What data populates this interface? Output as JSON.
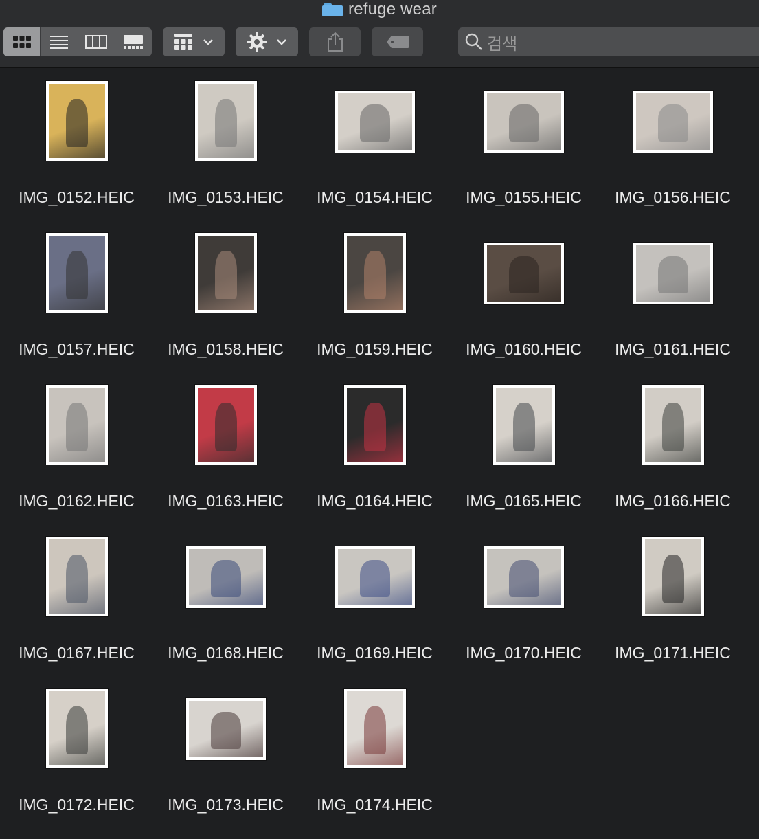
{
  "window": {
    "title": "refuge wear"
  },
  "toolbar": {
    "view_modes": [
      {
        "name": "icon-view",
        "icon": "grid-icon",
        "active": true
      },
      {
        "name": "list-view",
        "icon": "list-icon",
        "active": false
      },
      {
        "name": "column-view",
        "icon": "columns-icon",
        "active": false
      },
      {
        "name": "gallery-view",
        "icon": "gallery-icon",
        "active": false
      }
    ],
    "group_icon": "group-grid-icon",
    "action_icon": "gear-icon",
    "share_icon": "share-icon",
    "tag_icon": "tag-icon",
    "search_placeholder": "검색"
  },
  "files": [
    {
      "name": "IMG_0152.HEIC",
      "orient": "portrait",
      "bg": "#d9b35a",
      "fg": "#222"
    },
    {
      "name": "IMG_0153.HEIC",
      "orient": "portrait",
      "bg": "#cfcac2",
      "fg": "#777"
    },
    {
      "name": "IMG_0154.HEIC",
      "orient": "landscape",
      "bg": "#d4cfc8",
      "fg": "#666"
    },
    {
      "name": "IMG_0155.HEIC",
      "orient": "landscape",
      "bg": "#c9c4bd",
      "fg": "#666"
    },
    {
      "name": "IMG_0156.HEIC",
      "orient": "landscape",
      "bg": "#cec7c0",
      "fg": "#888"
    },
    {
      "name": "IMG_0157.HEIC",
      "orient": "portrait",
      "bg": "#6a6f86",
      "fg": "#333"
    },
    {
      "name": "IMG_0158.HEIC",
      "orient": "portrait",
      "bg": "#3f3b38",
      "fg": "#a88a7a"
    },
    {
      "name": "IMG_0159.HEIC",
      "orient": "portrait",
      "bg": "#4b4642",
      "fg": "#b0826a"
    },
    {
      "name": "IMG_0160.HEIC",
      "orient": "landscape",
      "bg": "#5a4d44",
      "fg": "#2b2420"
    },
    {
      "name": "IMG_0161.HEIC",
      "orient": "landscape",
      "bg": "#c4c1bd",
      "fg": "#777"
    },
    {
      "name": "IMG_0162.HEIC",
      "orient": "portrait",
      "bg": "#c8c3bd",
      "fg": "#777"
    },
    {
      "name": "IMG_0163.HEIC",
      "orient": "portrait",
      "bg": "#c23b47",
      "fg": "#2d2d2d"
    },
    {
      "name": "IMG_0164.HEIC",
      "orient": "portrait",
      "bg": "#2b2b2b",
      "fg": "#c33344"
    },
    {
      "name": "IMG_0165.HEIC",
      "orient": "portrait",
      "bg": "#d6d1ca",
      "fg": "#474a4e"
    },
    {
      "name": "IMG_0166.HEIC",
      "orient": "portrait",
      "bg": "#d2cdc6",
      "fg": "#3e413e"
    },
    {
      "name": "IMG_0167.HEIC",
      "orient": "portrait",
      "bg": "#cdc6bd",
      "fg": "#4d5566"
    },
    {
      "name": "IMG_0168.HEIC",
      "orient": "landscape",
      "bg": "#bfbcb8",
      "fg": "#3a4a7a"
    },
    {
      "name": "IMG_0169.HEIC",
      "orient": "landscape",
      "bg": "#c9c6c1",
      "fg": "#3e4f86"
    },
    {
      "name": "IMG_0170.HEIC",
      "orient": "landscape",
      "bg": "#c5c2bd",
      "fg": "#454f72"
    },
    {
      "name": "IMG_0171.HEIC",
      "orient": "portrait",
      "bg": "#d0cbc3",
      "fg": "#262626"
    },
    {
      "name": "IMG_0172.HEIC",
      "orient": "portrait",
      "bg": "#d6d0c8",
      "fg": "#3a3d3a"
    },
    {
      "name": "IMG_0173.HEIC",
      "orient": "landscape",
      "bg": "#d8d4cf",
      "fg": "#4a3a3a"
    },
    {
      "name": "IMG_0174.HEIC",
      "orient": "portrait",
      "bg": "#ddd9d4",
      "fg": "#7a3a3a"
    }
  ]
}
